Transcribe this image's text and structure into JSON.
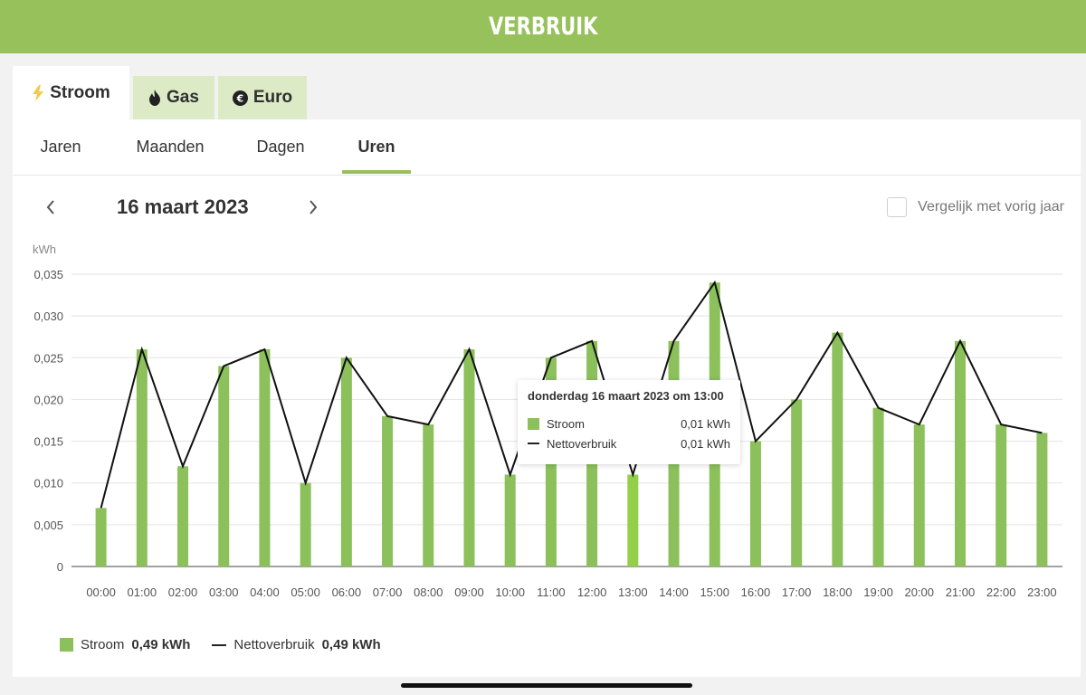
{
  "header": {
    "title": "VERBRUIK"
  },
  "tabs": [
    {
      "label": "Stroom",
      "icon": "lightning-icon",
      "active": true
    },
    {
      "label": "Gas",
      "icon": "flame-icon",
      "active": false
    },
    {
      "label": "Euro",
      "icon": "euro-icon",
      "active": false
    }
  ],
  "subtabs": [
    {
      "label": "Jaren"
    },
    {
      "label": "Maanden"
    },
    {
      "label": "Dagen"
    },
    {
      "label": "Uren",
      "active": true
    }
  ],
  "date_nav": {
    "date": "16 maart 2023",
    "compare_label": "Vergelijk met vorig jaar",
    "compare_checked": false
  },
  "tooltip": {
    "title": "donderdag 16 maart 2023 om 13:00",
    "rows": [
      {
        "name": "Stroom",
        "value": "0,01 kWh"
      },
      {
        "name": "Nettoverbruik",
        "value": "0,01 kWh"
      }
    ]
  },
  "legend": [
    {
      "name": "Stroom",
      "total": "0,49 kWh"
    },
    {
      "name": "Nettoverbruik",
      "total": "0,49 kWh"
    }
  ],
  "colors": {
    "accent": "#97c15a",
    "bar": "#8bc05a",
    "bar_highlight": "#93cf48",
    "line": "#111111",
    "tab_inactive": "#dcebc6"
  },
  "chart_data": {
    "type": "bar",
    "ylabel": "kWh",
    "ylim": [
      0,
      0.035
    ],
    "yticks": [
      "0",
      "0,005",
      "0,010",
      "0,015",
      "0,020",
      "0,025",
      "0,030",
      "0,035"
    ],
    "categories": [
      "00:00",
      "01:00",
      "02:00",
      "03:00",
      "04:00",
      "05:00",
      "06:00",
      "07:00",
      "08:00",
      "09:00",
      "10:00",
      "11:00",
      "12:00",
      "13:00",
      "14:00",
      "15:00",
      "16:00",
      "17:00",
      "18:00",
      "19:00",
      "20:00",
      "21:00",
      "22:00",
      "23:00"
    ],
    "highlight_index": 13,
    "grid": true,
    "legend_position": "bottom-left",
    "series": [
      {
        "name": "Stroom",
        "type": "bar",
        "values": [
          0.007,
          0.026,
          0.012,
          0.024,
          0.026,
          0.01,
          0.025,
          0.018,
          0.017,
          0.026,
          0.011,
          0.025,
          0.027,
          0.011,
          0.027,
          0.034,
          0.015,
          0.02,
          0.028,
          0.019,
          0.017,
          0.027,
          0.017,
          0.016
        ]
      },
      {
        "name": "Nettoverbruik",
        "type": "line",
        "values": [
          0.007,
          0.026,
          0.012,
          0.024,
          0.026,
          0.01,
          0.025,
          0.018,
          0.017,
          0.026,
          0.011,
          0.025,
          0.027,
          0.011,
          0.027,
          0.034,
          0.015,
          0.02,
          0.028,
          0.019,
          0.017,
          0.027,
          0.017,
          0.016
        ]
      }
    ]
  }
}
